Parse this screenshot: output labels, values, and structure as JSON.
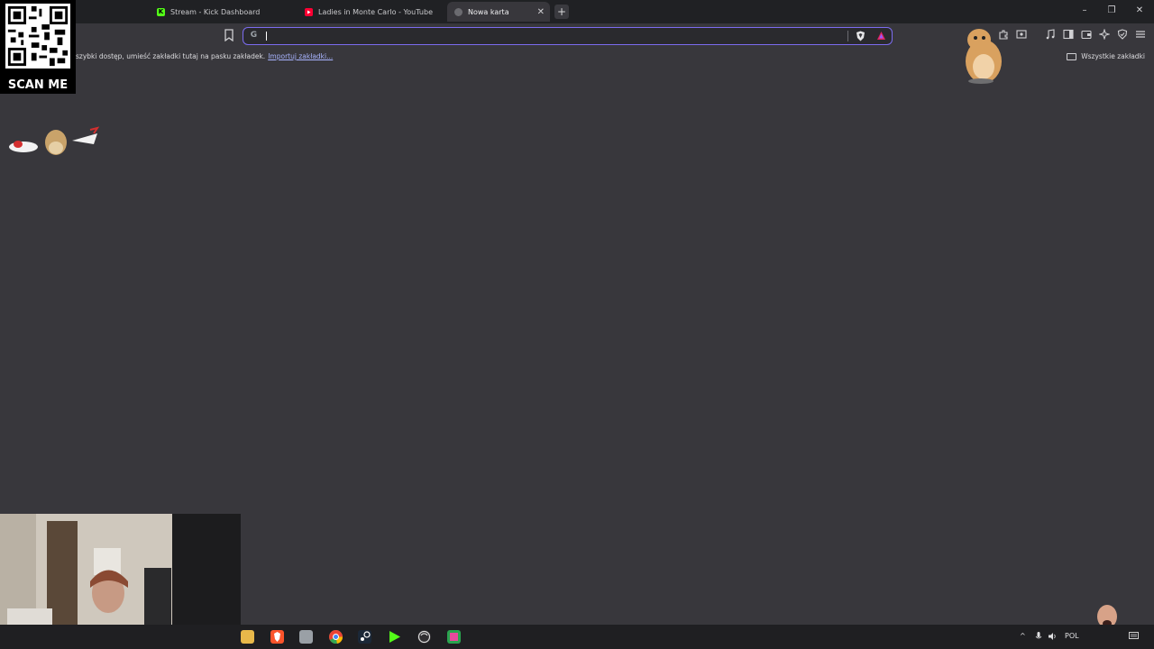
{
  "browser": {
    "tabs": [
      {
        "label": "Stream - Kick Dashboard",
        "icon": "kick-icon",
        "active": false
      },
      {
        "label": "Ladies in Monte Carlo - YouTube",
        "icon": "youtube-icon",
        "active": false
      },
      {
        "label": "Nowa karta",
        "icon": "brave-tab-icon",
        "active": true
      }
    ],
    "new_tab_label": "+",
    "window_controls": {
      "minimize": "–",
      "restore": "❐",
      "close": "✕"
    }
  },
  "omnibox": {
    "value": "",
    "placeholder": "",
    "icon": "google-icon",
    "border_color": "#7c6cf0"
  },
  "bookmarks_bar": {
    "message": "szybki dostęp, umieść zakładki tutaj na pasku zakładek.",
    "import_link": "Importuj zakładki...",
    "all_bookmarks": "Wszystkie zakładki"
  },
  "overlay": {
    "qr_label": "SCAN ME"
  },
  "taskbar": {
    "apps": [
      "file-explorer-icon",
      "brave-icon",
      "app-icon",
      "chrome-icon",
      "steam-icon",
      "game-launcher-icon",
      "obs-icon",
      "stream-app-icon"
    ],
    "tray": {
      "language": "POL"
    }
  },
  "colors": {
    "page_bg": "#38373c",
    "tabbar_bg": "#202124",
    "accent": "#7c6cf0"
  }
}
